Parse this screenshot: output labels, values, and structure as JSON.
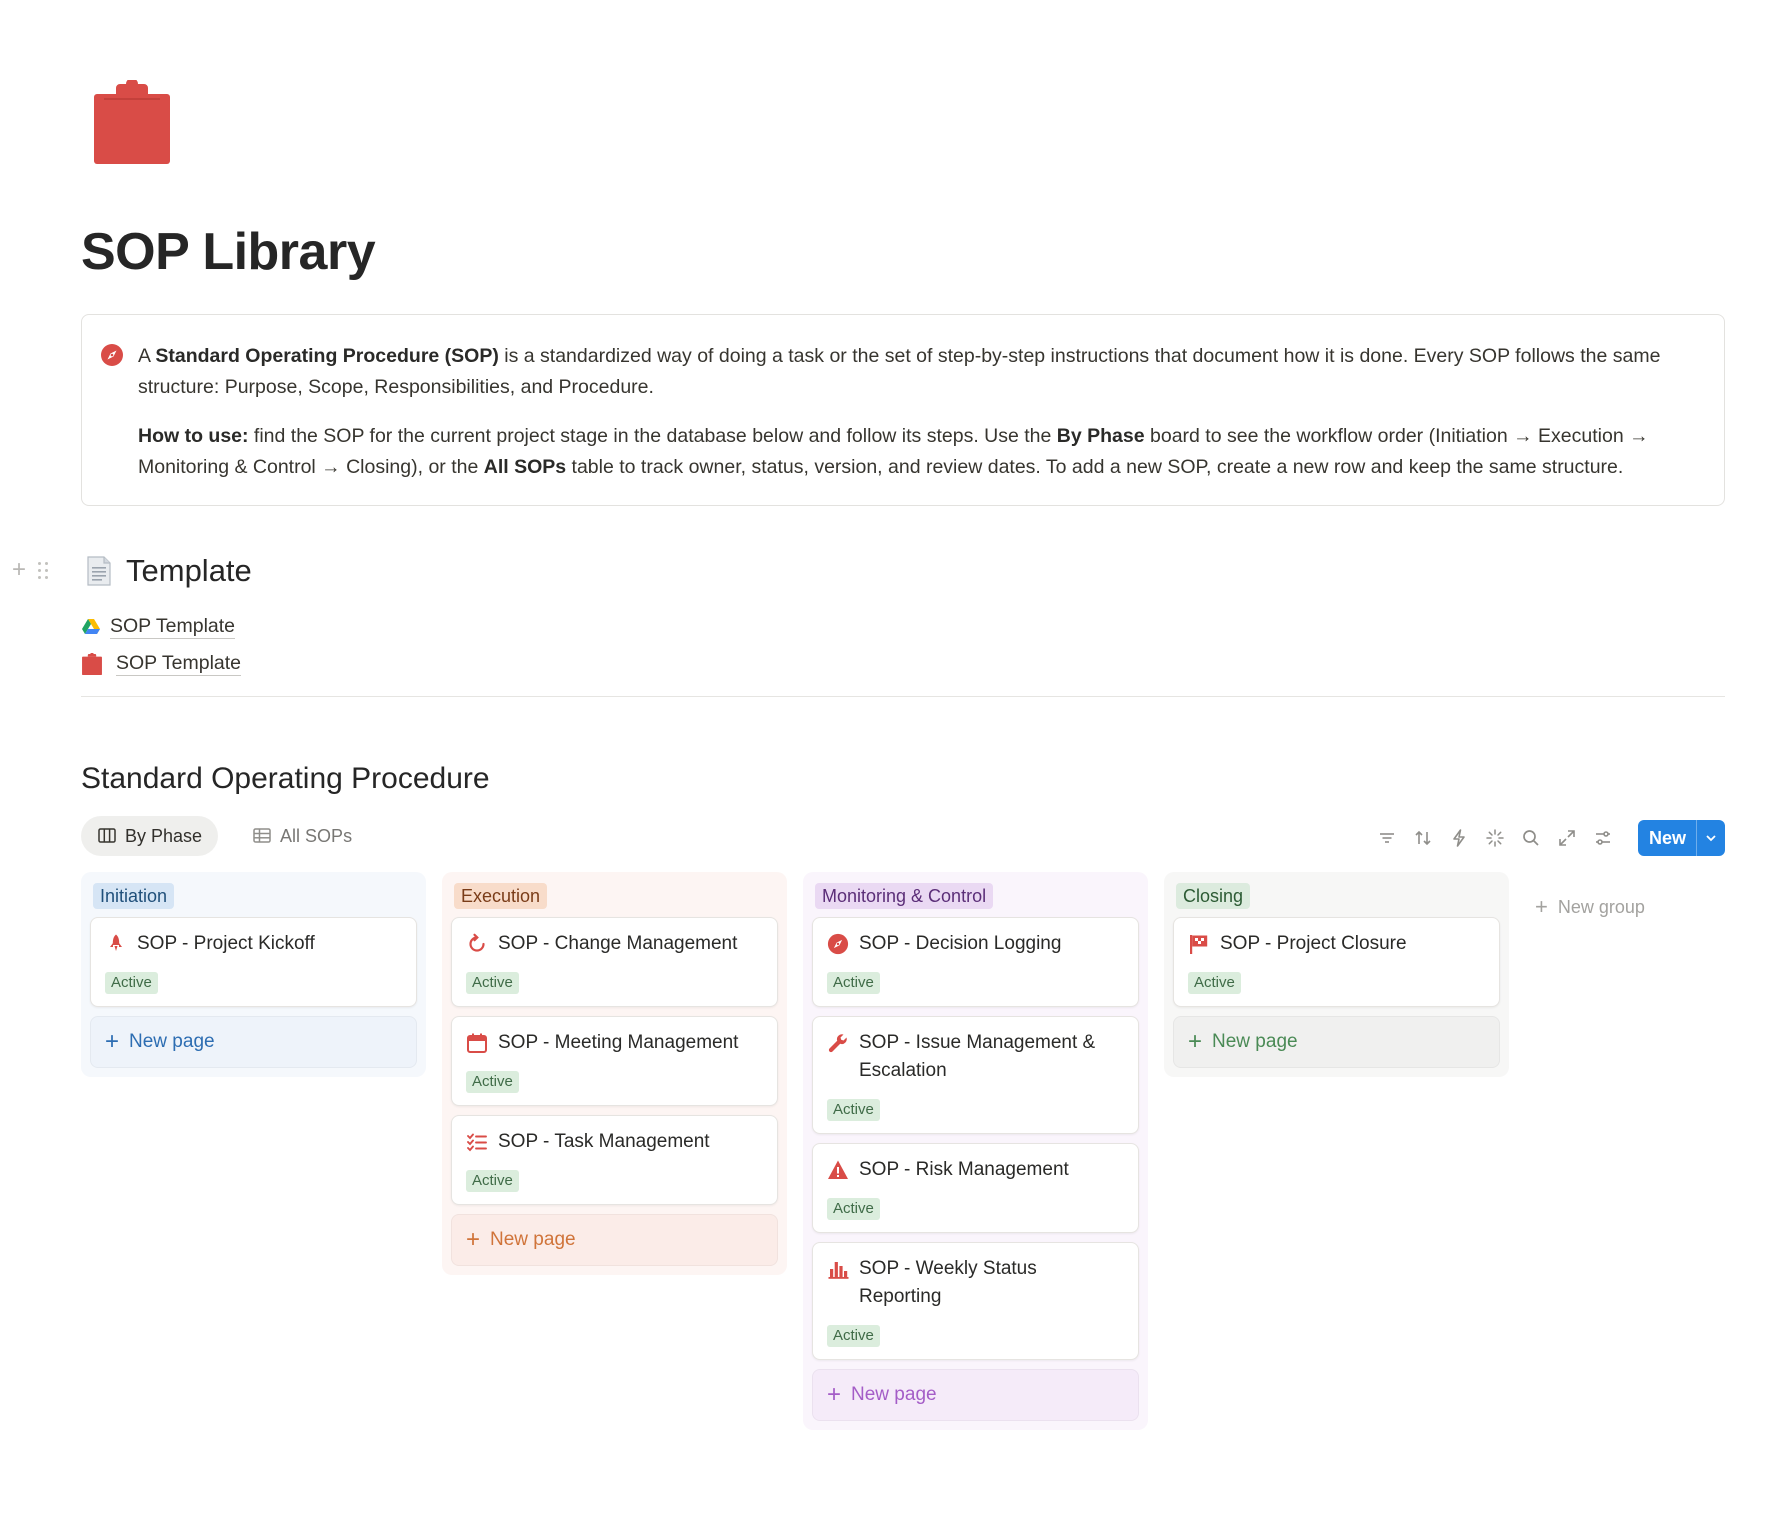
{
  "page": {
    "title": "SOP Library",
    "icon": "clipboard-icon",
    "accent_color": "#d94c47"
  },
  "callout": {
    "icon": "compass-icon",
    "p1": {
      "pre": "A ",
      "bold": "Standard Operating Procedure (SOP)",
      "post": " is a standardized way of doing a task or the set of step-by-step instructions that document how it is done. Every SOP follows the same structure: Purpose, Scope, Responsibilities, and Procedure."
    },
    "p2": {
      "bold1": "How to use:",
      "text1": " find the SOP for the current project stage in the database below and follow its steps. Use the ",
      "bold2": "By Phase",
      "text2": " board to see the workflow order (Initiation → Execution → Monitoring & Control → Closing), or the ",
      "bold3": "All SOPs",
      "text3": " table to track owner, status, version, and review dates. To add a new SOP, create a new row and keep the same structure."
    }
  },
  "template_section": {
    "heading": "Template",
    "links": [
      {
        "label": "SOP Template",
        "icon": "google-drive-icon"
      },
      {
        "label": "SOP Template",
        "icon": "clipboard-icon"
      }
    ]
  },
  "database": {
    "title": "Standard Operating Procedure",
    "views": [
      {
        "label": "By Phase",
        "icon": "board-icon",
        "active": true
      },
      {
        "label": "All SOPs",
        "icon": "table-icon",
        "active": false
      }
    ],
    "toolbar": {
      "tools": [
        "filter-icon",
        "sort-icon",
        "automation-icon",
        "ai-sparkle-icon",
        "search-icon",
        "expand-icon",
        "settings-icon"
      ],
      "new_label": "New"
    },
    "groups": [
      {
        "name": "Initiation",
        "cards": [
          {
            "title": "SOP - Project Kickoff",
            "icon": "rocket-icon",
            "status": "Active"
          }
        ],
        "new_page_label": "New page"
      },
      {
        "name": "Execution",
        "cards": [
          {
            "title": "SOP - Change Management",
            "icon": "refresh-icon",
            "status": "Active"
          },
          {
            "title": "SOP - Meeting Management",
            "icon": "calendar-icon",
            "status": "Active"
          },
          {
            "title": "SOP - Task Management",
            "icon": "checklist-icon",
            "status": "Active"
          }
        ],
        "new_page_label": "New page"
      },
      {
        "name": "Monitoring & Control",
        "cards": [
          {
            "title": "SOP - Decision Logging",
            "icon": "compass-icon",
            "status": "Active"
          },
          {
            "title": "SOP - Issue Management & Escalation",
            "icon": "wrench-icon",
            "status": "Active"
          },
          {
            "title": "SOP - Risk Management",
            "icon": "warning-icon",
            "status": "Active"
          },
          {
            "title": "SOP - Weekly Status Reporting",
            "icon": "bar-chart-icon",
            "status": "Active"
          }
        ],
        "new_page_label": "New page"
      },
      {
        "name": "Closing",
        "cards": [
          {
            "title": "SOP - Project Closure",
            "icon": "flag-icon",
            "status": "Active"
          }
        ],
        "new_page_label": "New page"
      }
    ],
    "new_group_label": "New group"
  }
}
